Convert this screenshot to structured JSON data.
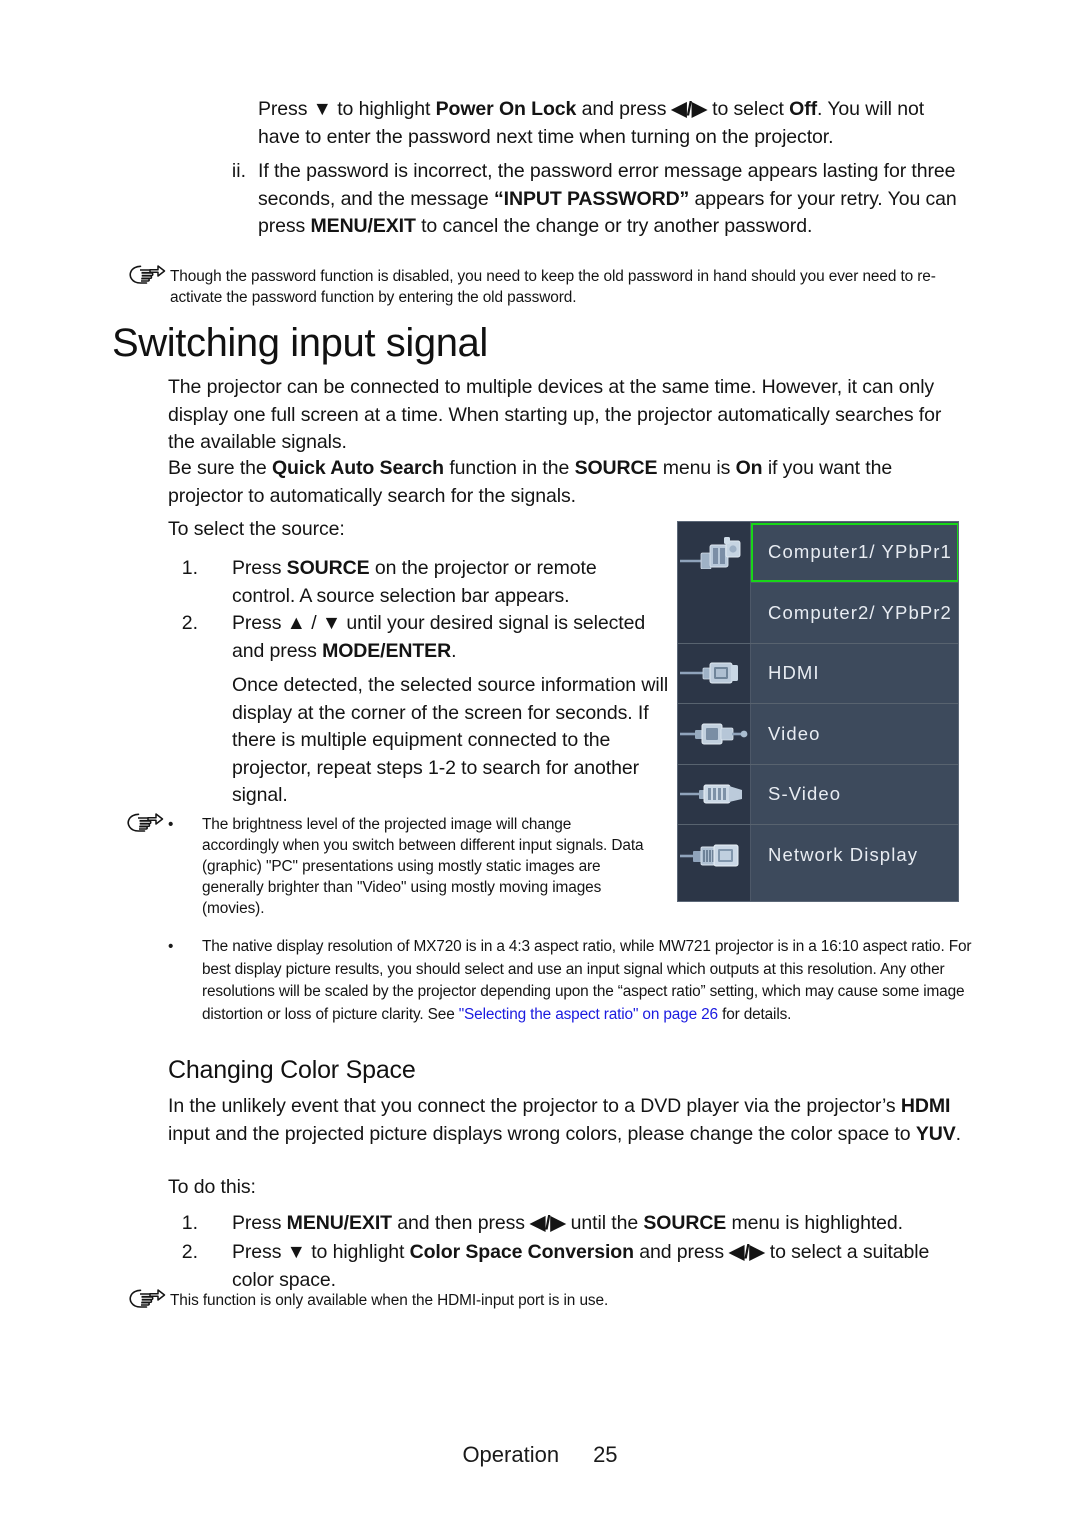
{
  "page": {
    "footer_section": "Operation",
    "footer_page_number": "25"
  },
  "top_section": {
    "para_continuation": {
      "pre": "Press ",
      "icon_down": "▼",
      "mid1": " to highlight ",
      "bold1": "Power On Lock",
      "mid2": " and press ",
      "icon_left": "◀",
      "slash": "/",
      "icon_right": "▶",
      "mid3": " to select ",
      "bold2": "Off",
      "tail": ". You will not have to enter the password next time when turning on the projector."
    },
    "item_ii": {
      "marker": "ii.",
      "t1": "If the password is incorrect, the password error message appears lasting for three seconds, and the message ",
      "bold1": "“INPUT PASSWORD”",
      "t2": " appears for your retry. You can press ",
      "bold2": "MENU/EXIT",
      "t3": " to cancel the change or try another password."
    },
    "note": "Though the password function is disabled, you need to keep the old password in hand should you ever need to re-activate the password function by entering the old password."
  },
  "switching": {
    "heading": "Switching input signal",
    "para1": "The projector can be connected to multiple devices at the same time. However, it can only display one full screen at a time. When starting up, the projector automatically searches for the available signals.",
    "para2": {
      "t1": "Be sure the ",
      "bold1": "Quick Auto Search",
      "t2": " function in the ",
      "bold2": "SOURCE",
      "t3": " menu is ",
      "bold3": "On",
      "t4": " if you want the projector to automatically search for the signals."
    },
    "to_select_label": "To select the source:",
    "steps": [
      {
        "marker": "1.",
        "t1": "Press ",
        "bold1": "SOURCE",
        "t2": " on the projector or remote control. A source selection bar appears."
      },
      {
        "marker": "2.",
        "t1": "Press ",
        "icon_up": "▲",
        "slash": " / ",
        "icon_down": "▼",
        "t2": " until your desired signal is selected and press ",
        "bold1": "MODE/ENTER",
        "t3": "."
      }
    ],
    "step_note": "Once detected, the selected source information will display at the corner of the screen for seconds. If there is multiple equipment connected to the projector, repeat steps 1-2 to search for another signal.",
    "bullet_note_1": {
      "bullet": "•",
      "text": "The brightness level of the projected image will change accordingly when you switch between different input signals. Data (graphic) \"PC\" presentations using mostly static images are generally brighter than \"Video\" using mostly moving images (movies)."
    },
    "bullet_note_2": {
      "bullet": "•",
      "t1": "The native display resolution of MX720 is in a  4:3 aspect ratio, while MW721 projector is in a 16:10 aspect ratio. For best display picture results, you should select and use an input signal which outputs at this resolution. Any other resolutions will be scaled by the projector depending upon the “aspect ratio” setting, which may cause some image distortion or loss of picture clarity. See ",
      "link1": "\"Selecting the aspect ratio\" on page 26",
      "t2": " for details."
    }
  },
  "osd": {
    "selected_index": 0,
    "highlight_color": "#18d618",
    "panel_bg": "#3d4a5c",
    "icon_col_bg": "#2c3647",
    "text_color": "#e8ecf2",
    "items": [
      {
        "label": "Computer1/ YPbPr1",
        "icon": "vga-connector-icon",
        "shares_icon": true
      },
      {
        "label": "Computer2/ YPbPr2",
        "icon": "vga-connector-icon",
        "shares_icon": false
      },
      {
        "label": "HDMI",
        "icon": "hdmi-connector-icon",
        "shares_icon": false
      },
      {
        "label": "Video",
        "icon": "composite-video-connector-icon",
        "shares_icon": false
      },
      {
        "label": "S-Video",
        "icon": "s-video-connector-icon",
        "shares_icon": false
      },
      {
        "label": "Network Display",
        "icon": "network-connector-icon",
        "shares_icon": false
      }
    ]
  },
  "color_space": {
    "heading": "Changing Color Space",
    "para": {
      "t1": "In the unlikely event that you connect the projector to a DVD player via the projector’s ",
      "bold1": "HDMI",
      "t2": " input and the projected picture displays wrong colors, please change the color space to ",
      "bold2": "YUV",
      "t3": "."
    },
    "to_do_label": "To do this:",
    "steps": [
      {
        "marker": "1.",
        "t1": "Press ",
        "bold1": "MENU/EXIT",
        "t2": " and then press ",
        "icon_left": "◀",
        "slash": "/",
        "icon_right": "▶",
        "t3": " until the ",
        "bold2": "SOURCE",
        "t4": " menu is highlighted."
      },
      {
        "marker": "2.",
        "t1": "Press ",
        "icon_down": "▼",
        "t2": " to highlight ",
        "bold1": "Color Space Conversion",
        "t3": " and press ",
        "icon_left": "◀",
        "slash": "/",
        "icon_right": "▶",
        "t4": " to select a suitable color space."
      }
    ],
    "note": "This function is only available when the HDMI-input port is in use."
  }
}
